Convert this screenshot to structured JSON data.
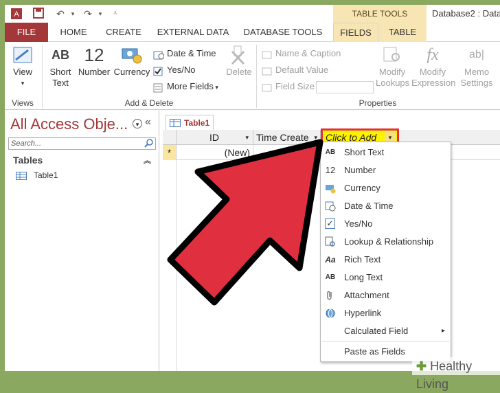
{
  "window": {
    "doc_title": "Database2 : Data",
    "context_group": "TABLE TOOLS"
  },
  "tabs": [
    "FILE",
    "HOME",
    "CREATE",
    "EXTERNAL DATA",
    "DATABASE TOOLS",
    "FIELDS",
    "TABLE"
  ],
  "ribbon": {
    "views": {
      "view_label": "View",
      "group_label": "Views"
    },
    "add_delete": {
      "short_text": "Short Text",
      "number": "Number",
      "currency": "Currency",
      "date_time": "Date & Time",
      "yes_no": "Yes/No",
      "more_fields": "More Fields",
      "delete": "Delete",
      "group_label": "Add & Delete",
      "ab_glyph": "AB",
      "num_glyph": "12"
    },
    "properties": {
      "name_caption": "Name & Caption",
      "default_value": "Default Value",
      "field_size": "Field Size",
      "modify_lookups": "Modify Lookups",
      "modify_expression": "Modify Expression",
      "memo_settings": "Memo Settings",
      "group_label": "Properties",
      "fx_glyph": "fx",
      "ab_glyph": "ab|"
    }
  },
  "nav": {
    "title": "All Access Obje...",
    "search_placeholder": "Search...",
    "section": "Tables",
    "item": "Table1"
  },
  "document": {
    "tab_label": "Table1",
    "columns": [
      "ID",
      "Time Create",
      "Click to Add"
    ],
    "new_row_marker": "*",
    "new_row_value": "(New)"
  },
  "menu": {
    "items": [
      {
        "label": "Short Text",
        "icon": "ab-icon",
        "glyph": "AB"
      },
      {
        "label": "Number",
        "icon": "number-icon",
        "glyph": "12"
      },
      {
        "label": "Currency",
        "icon": "currency-icon",
        "glyph": ""
      },
      {
        "label": "Date & Time",
        "icon": "calendar-icon",
        "glyph": ""
      },
      {
        "label": "Yes/No",
        "icon": "checkbox-icon",
        "glyph": "✓"
      },
      {
        "label": "Lookup & Relationship",
        "icon": "lookup-icon",
        "glyph": ""
      },
      {
        "label": "Rich Text",
        "icon": "rich-text-icon",
        "glyph": "Aa"
      },
      {
        "label": "Long Text",
        "icon": "long-text-icon",
        "glyph": "AB"
      },
      {
        "label": "Attachment",
        "icon": "paperclip-icon",
        "glyph": "0"
      },
      {
        "label": "Hyperlink",
        "icon": "globe-icon",
        "glyph": ""
      },
      {
        "label": "Calculated Field",
        "icon": "none",
        "glyph": ""
      },
      {
        "label": "Paste as Fields",
        "icon": "none",
        "glyph": ""
      }
    ],
    "submenu_arrow": "▸"
  },
  "watermark": "Healthy Living",
  "colors": {
    "accent": "#a4373a",
    "context": "#f7e5b4",
    "highlight_box": "#e0313b",
    "click_to_add_bg": "#fff200",
    "arrow_fill": "#e03040"
  }
}
